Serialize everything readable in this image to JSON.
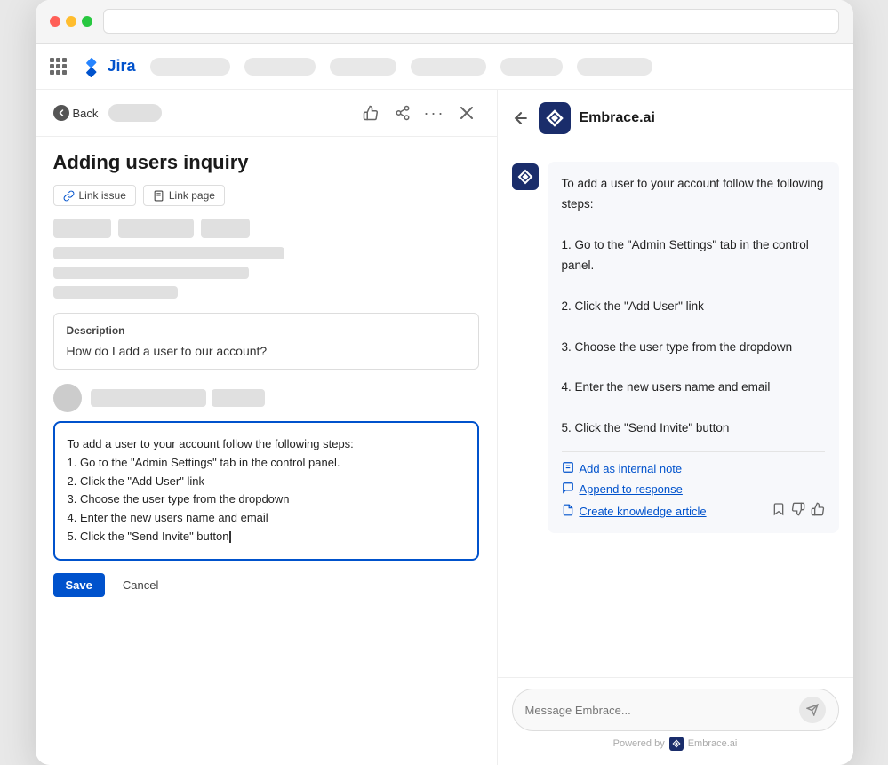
{
  "browser": {
    "dots": [
      "red",
      "yellow",
      "green"
    ]
  },
  "jira": {
    "logo_text": "Jira",
    "nav_pills": [
      120,
      100,
      90,
      110,
      95,
      110
    ]
  },
  "left": {
    "back_label": "Back",
    "toolbar_pill_width": 60,
    "issue_title": "Adding users inquiry",
    "link_issue_label": "Link issue",
    "link_page_label": "Link page",
    "meta_pills": [
      60,
      80,
      55
    ],
    "meta_rows": [
      240,
      200,
      130
    ],
    "description": {
      "label": "Description",
      "text": "How do I add a user to our account?"
    },
    "ai_response": {
      "line1": "To add a user to your account follow the following steps:",
      "steps": [
        "1. Go to the \"Admin Settings\" tab in the control panel.",
        "2. Click the \"Add User\" link",
        "3. Choose the user type from the dropdown",
        "4. Enter the new users name and email",
        "5. Click the \"Send Invite\" button"
      ]
    },
    "save_label": "Save",
    "cancel_label": "Cancel"
  },
  "right": {
    "back_icon": "←",
    "brand_name": "Embrace.ai",
    "message": {
      "intro": "To add a user to your account follow the following steps:",
      "steps": [
        "1. Go to the \"Admin Settings\" tab in the control panel.",
        "2. Click the \"Add User\" link",
        "3. Choose the user type from the dropdown",
        "4. Enter the new users name and email",
        "5. Click the \"Send Invite\" button"
      ]
    },
    "actions": {
      "internal_note": "Add as internal note",
      "append_response": "Append to response",
      "create_article": "Create knowledge article"
    },
    "input_placeholder": "Message Embrace...",
    "powered_by": "Powered by",
    "powered_by_brand": "Embrace.ai",
    "send_icon": "➤"
  }
}
